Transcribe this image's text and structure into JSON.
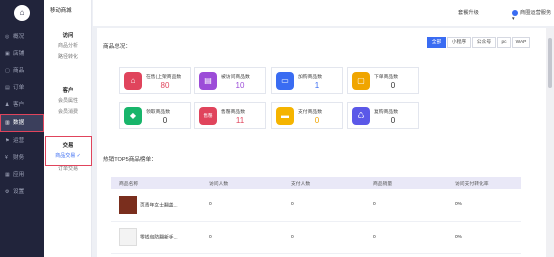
{
  "sidebar": {
    "logo_glyph": "⌂",
    "items": [
      {
        "label": "概况",
        "icon": "home-icon",
        "glyph": "◎"
      },
      {
        "label": "店铺",
        "icon": "store-icon",
        "glyph": "▣"
      },
      {
        "label": "商品",
        "icon": "goods-icon",
        "glyph": "▢"
      },
      {
        "label": "订单",
        "icon": "order-icon",
        "glyph": "▤"
      },
      {
        "label": "客户",
        "icon": "customer-icon",
        "glyph": "♟"
      },
      {
        "label": "数据",
        "icon": "data-icon",
        "glyph": "▥"
      },
      {
        "label": "运营",
        "icon": "operate-icon",
        "glyph": "⚑"
      },
      {
        "label": "财务",
        "icon": "finance-icon",
        "glyph": "¥"
      },
      {
        "label": "应用",
        "icon": "apps-icon",
        "glyph": "▦"
      },
      {
        "label": "设置",
        "icon": "settings-icon",
        "glyph": "⚙"
      }
    ]
  },
  "subnav": {
    "shop_name": "移动商城",
    "groups": [
      {
        "title": "访问",
        "links": [
          "商品分析",
          "路径转化"
        ]
      },
      {
        "title": "客户",
        "links": [
          "会员属性",
          "会员消费"
        ]
      },
      {
        "title": "交易",
        "links": [
          "商品交易 ✓",
          "订单交易"
        ]
      }
    ]
  },
  "topbar": {
    "upgrade": "套餐升级",
    "user": "商圈运营服务 ▾"
  },
  "filters": [
    "全部",
    "小程序",
    "公众号",
    "pc",
    "WAP"
  ],
  "overview_title": "商品总况：",
  "cards": [
    {
      "label": "在售(上架商品数",
      "value": "80",
      "color": "#e0445c",
      "icon": "shelf-icon",
      "glyph": "⌂"
    },
    {
      "label": "被访问商品数",
      "value": "10",
      "color": "#9c4cd8",
      "icon": "visit-icon",
      "glyph": "▤"
    },
    {
      "label": "加购商品数",
      "value": "1",
      "color": "#3a6cf2",
      "icon": "cart-icon",
      "glyph": "▭"
    },
    {
      "label": "下单商品数",
      "value": "0",
      "color": "#f0a500",
      "icon": "order-icon",
      "glyph": "▢"
    },
    {
      "label": "领取商品数",
      "value": "0",
      "color": "#18b56b",
      "icon": "gift-icon",
      "glyph": "◆"
    },
    {
      "label": "售罄商品数",
      "value": "11",
      "color": "#e0445c",
      "icon": "soldout-icon",
      "glyph": "售罄"
    },
    {
      "label": "支付商品数",
      "value": "0",
      "color": "#f5b400",
      "icon": "pay-icon",
      "glyph": "▬"
    },
    {
      "label": "复购商品数",
      "value": "0",
      "color": "#5b58e8",
      "icon": "repurchase-icon",
      "glyph": "♺"
    }
  ],
  "top_title": "热销TOP5商品榜单：",
  "table": {
    "headers": [
      "商品名称",
      "访问人数",
      "支付人数",
      "商品销量",
      "访问支付转化率"
    ],
    "rows": [
      {
        "name": "页青年女士翻盖...",
        "visits": "0",
        "payers": "0",
        "sales": "0",
        "rate": "0%"
      },
      {
        "name": "零钱包防翻新手...",
        "visits": "0",
        "payers": "0",
        "sales": "0",
        "rate": "0%"
      }
    ]
  }
}
